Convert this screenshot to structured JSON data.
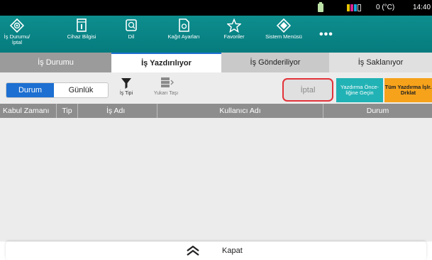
{
  "status_bar": {
    "temperature": "0 (°C)",
    "time": "14:40",
    "toner_colors": [
      "#e8c300",
      "#d8258f",
      "#19a7dc",
      "#222222"
    ]
  },
  "top_nav": [
    {
      "label": "İş Durumu/ İptal",
      "icon": "job-status-icon"
    },
    {
      "label": "Cihaz Bilgisi",
      "icon": "device-info-icon"
    },
    {
      "label": "Dil",
      "icon": "language-icon"
    },
    {
      "label": "Kağıt Ayarları",
      "icon": "paper-settings-icon"
    },
    {
      "label": "Favoriler",
      "icon": "star-icon"
    },
    {
      "label": "Sistem Menüsü",
      "icon": "system-menu-icon"
    }
  ],
  "more": "•••",
  "tabs": [
    "İş Durumu",
    "İş Yazdırılıyor",
    "İş Gönderiliyor",
    "İş Saklanıyor"
  ],
  "active_tab": "İş Yazdırılıyor",
  "toolbar": {
    "segment": [
      "Durum",
      "Günlük"
    ],
    "job_type_label": "İş Tipi",
    "move_up_label": "Yukarı Taşı",
    "cancel_label": "İptal",
    "interrupt_label": "Yazdırma Önce- liğine Geçin",
    "print_all_label": "Tüm Yazdırma İşlr. Drklat"
  },
  "table": {
    "columns": [
      "Kabul Zamanı",
      "Tip",
      "İş Adı",
      "Kullanıcı Adı",
      "Durum"
    ],
    "rows": []
  },
  "footer": {
    "close_label": "Kapat"
  }
}
